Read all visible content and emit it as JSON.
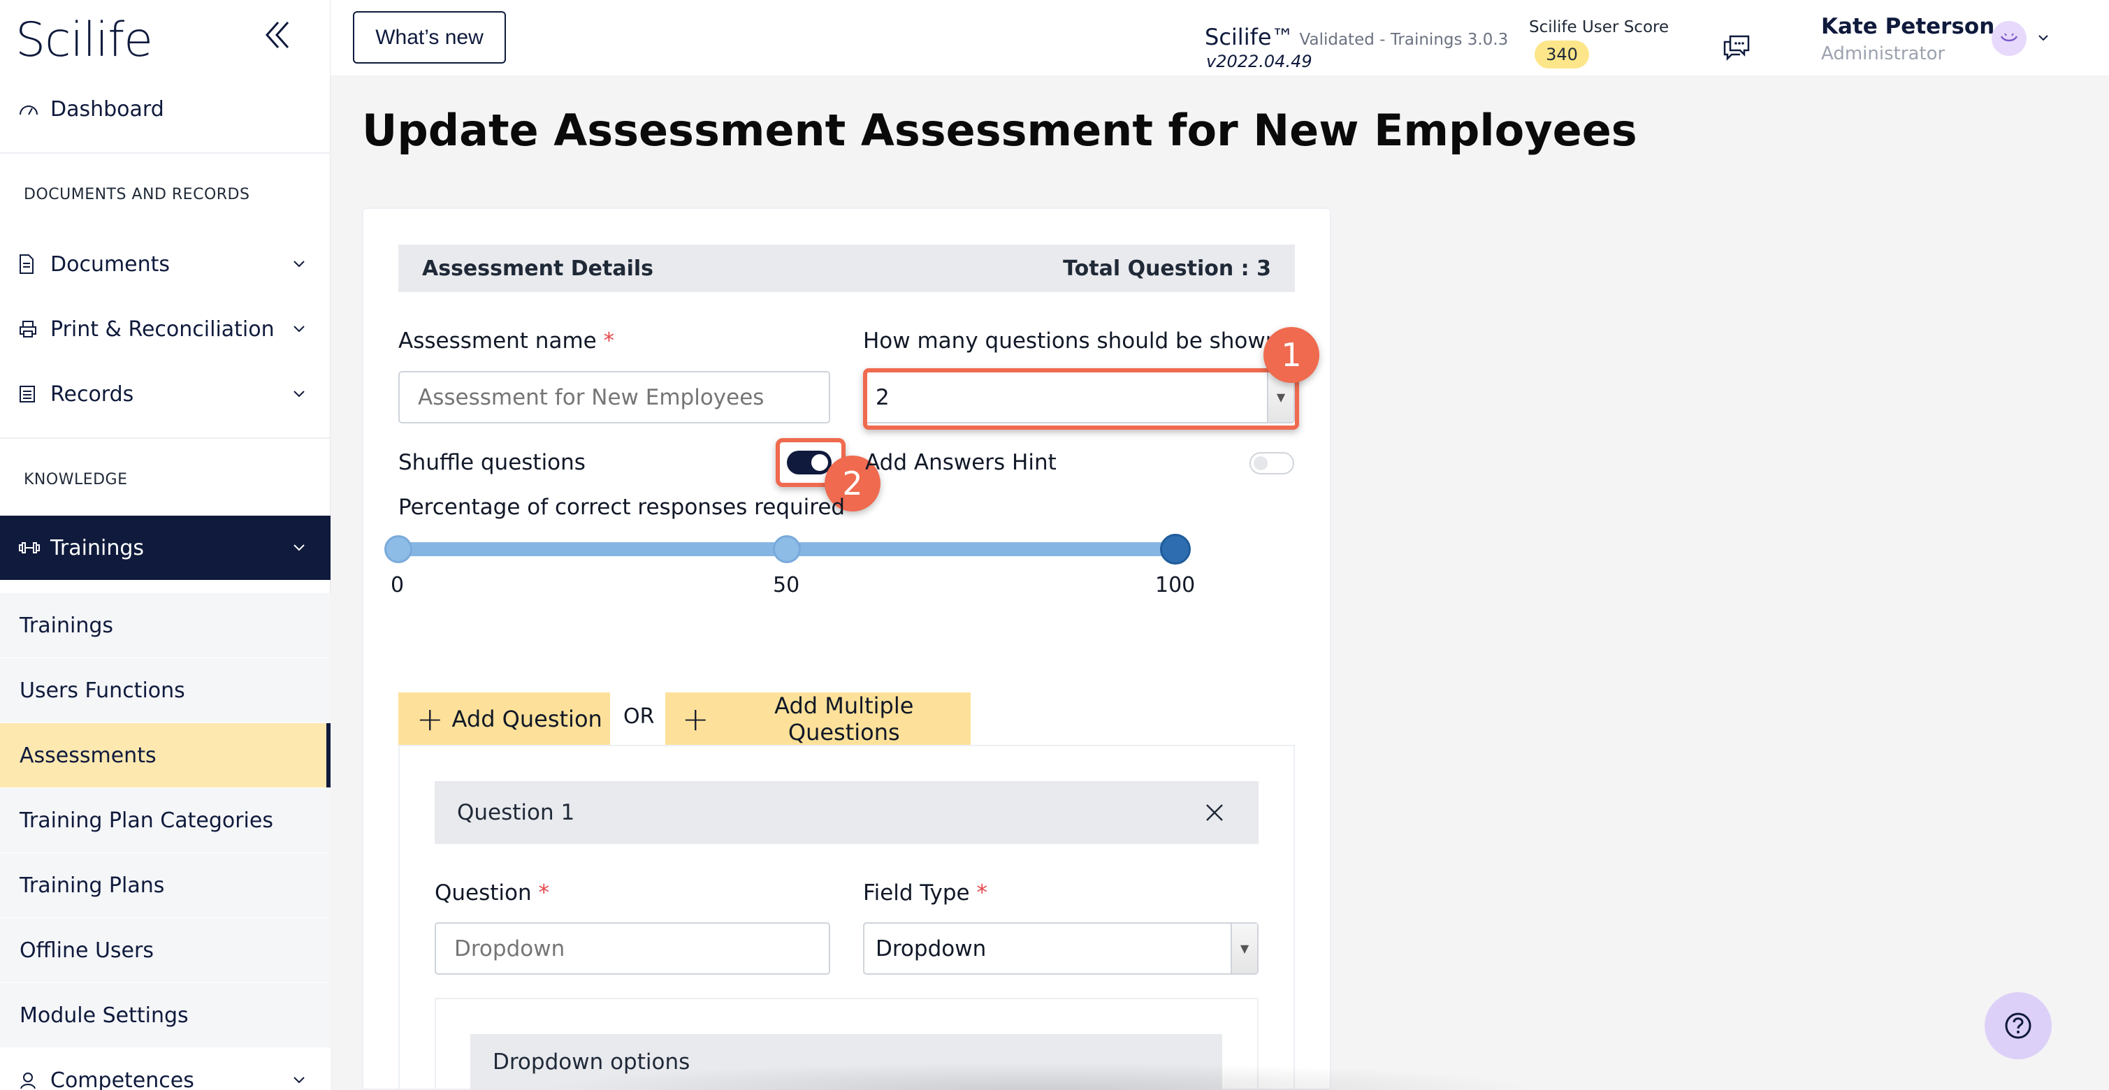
{
  "app": {
    "logo_text": "Scilife"
  },
  "sidebar": {
    "dashboard": "Dashboard",
    "section_documents": "DOCUMENTS AND RECORDS",
    "documents": "Documents",
    "print": "Print & Reconciliation",
    "records": "Records",
    "section_knowledge": "KNOWLEDGE",
    "trainings_group": "Trainings",
    "sub_items": [
      "Trainings",
      "Users Functions",
      "Assessments",
      "Training Plan Categories",
      "Training Plans",
      "Offline Users",
      "Module Settings"
    ],
    "competences": "Competences",
    "active_item": "Assessments"
  },
  "header": {
    "whats_new": "What’s new",
    "brand": "Scilife™",
    "validated": "Validated - Trainings 3.0.3",
    "version": "v2022.04.49",
    "score_label": "Scilife User Score",
    "score_value": "340",
    "user_name": "Kate Peterson",
    "user_role": "Administrator"
  },
  "page": {
    "title": "Update Assessment Assessment for New Employees"
  },
  "details": {
    "section_title": "Assessment Details",
    "total_questions": "Total Question : 3",
    "name_label": "Assessment name",
    "name_placeholder": "Assessment for New Employees",
    "count_label": "How many questions should be shown",
    "count_value": "2",
    "shuffle_label": "Shuffle questions",
    "shuffle_on": true,
    "hint_label": "Add Answers Hint",
    "hint_on": false,
    "percent_label": "Percentage of correct responses required",
    "slider_ticks": [
      "0",
      "50",
      "100"
    ],
    "slider_value": 100
  },
  "markers": {
    "one": "1",
    "two": "2"
  },
  "actions": {
    "add_question": "Add Question",
    "or": "OR",
    "add_multiple": "Add Multiple Questions"
  },
  "question": {
    "title": "Question 1",
    "question_label": "Question",
    "question_placeholder": "Dropdown",
    "field_type_label": "Field Type",
    "field_type_value": "Dropdown",
    "dropdown_options": "Dropdown options"
  },
  "colors": {
    "navy": "#0f1a3c",
    "active_bg": "#fde8b0",
    "button_yellow": "#fde19a",
    "annotation": "#ef6a4f",
    "slider": "#85b5e2"
  }
}
